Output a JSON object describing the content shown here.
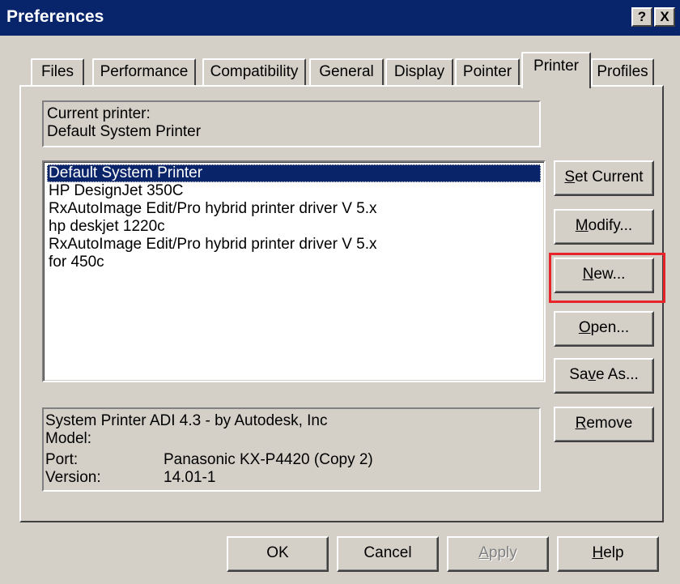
{
  "window": {
    "title": "Preferences",
    "help_btn": "?",
    "close_btn": "X"
  },
  "tabs": [
    "Files",
    "Performance",
    "Compatibility",
    "General",
    "Display",
    "Pointer",
    "Printer",
    "Profiles"
  ],
  "active_tab": "Printer",
  "current_printer": {
    "label": "Current printer:",
    "value": "Default System Printer"
  },
  "printers": [
    "Default System Printer",
    "HP DesignJet 350C",
    "RxAutoImage Edit/Pro hybrid printer driver V 5.x",
    "hp deskjet 1220c",
    "RxAutoImage Edit/Pro hybrid printer driver V 5.x",
    "for 450c"
  ],
  "selected_printer_index": 0,
  "side_buttons": {
    "set_current": {
      "pre": "",
      "key": "S",
      "post": "et Current"
    },
    "modify": {
      "pre": "",
      "key": "M",
      "post": "odify..."
    },
    "new": {
      "pre": "",
      "key": "N",
      "post": "ew..."
    },
    "open": {
      "pre": "",
      "key": "O",
      "post": "pen..."
    },
    "save_as": {
      "pre": "Sa",
      "key": "v",
      "post": "e As..."
    },
    "remove": {
      "pre": "",
      "key": "R",
      "post": "emove"
    }
  },
  "info": {
    "description": "System Printer ADI 4.3 - by Autodesk, Inc",
    "model_label": "Model:",
    "model_value": "",
    "port_label": "Port:",
    "port_value": "Panasonic KX-P4420 (Copy 2)",
    "version_label": "Version:",
    "version_value": "14.01-1"
  },
  "bottom_buttons": {
    "ok": "OK",
    "cancel": "Cancel",
    "apply": {
      "key": "A",
      "post": "pply"
    },
    "help": {
      "key": "H",
      "post": "elp"
    }
  },
  "colors": {
    "title_bar": "#08246b",
    "selection": "#0a246a",
    "highlight_box": "#e8242b",
    "face": "#d4d0c8"
  }
}
